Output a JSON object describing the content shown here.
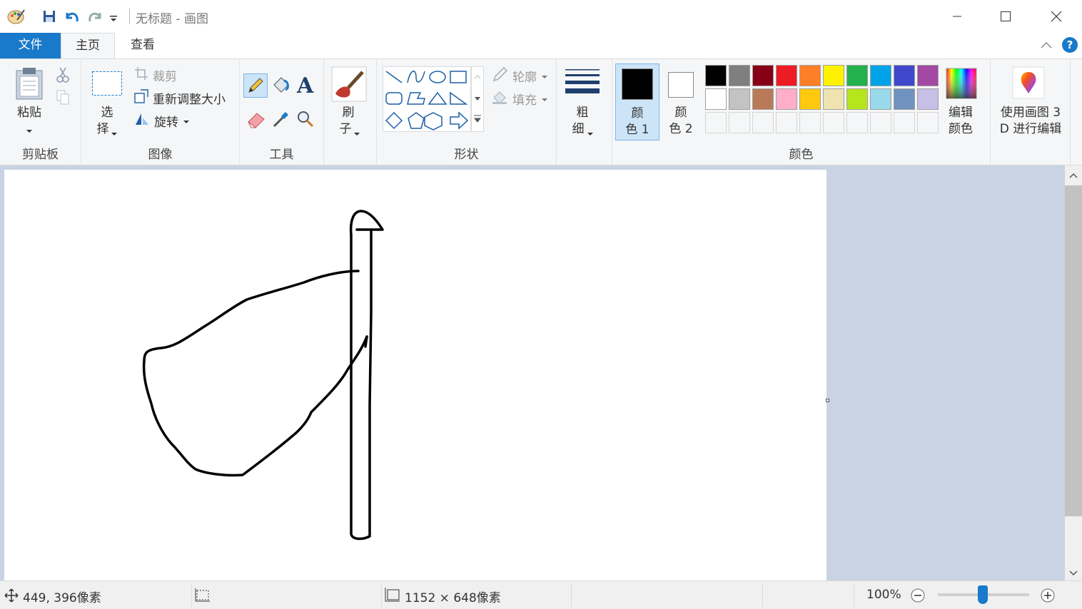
{
  "window": {
    "title": "无标题 - 画图"
  },
  "tabs": {
    "file": "文件",
    "home": "主页",
    "view": "查看"
  },
  "clipboard": {
    "paste": "粘贴",
    "group": "剪贴板"
  },
  "image": {
    "select_line1": "选",
    "select_line2": "择",
    "crop": "裁剪",
    "resize": "重新调整大小",
    "rotate": "旋转",
    "group": "图像"
  },
  "tools": {
    "group": "工具"
  },
  "brush": {
    "line1": "刷",
    "line2": "子"
  },
  "shapes": {
    "outline": "轮廓",
    "fill": "填充",
    "group": "形状"
  },
  "size": {
    "line1": "粗",
    "line2": "细"
  },
  "colors": {
    "color1_line1": "颜",
    "color1_line2": "色 1",
    "color2_line1": "颜",
    "color2_line2": "色 2",
    "edit_line1": "编辑",
    "edit_line2": "颜色",
    "group": "颜色",
    "paint3d_line1": "使用画图 3",
    "paint3d_line2": "D 进行编辑",
    "palette_row1": [
      "#000000",
      "#7f7f7f",
      "#880015",
      "#ed1c24",
      "#ff7f27",
      "#fff200",
      "#22b14c",
      "#00a2e8",
      "#3f48cc",
      "#a349a4"
    ],
    "palette_row2": [
      "#ffffff",
      "#c3c3c3",
      "#b97a57",
      "#ffaec9",
      "#ffc90e",
      "#efe4b0",
      "#b5e61d",
      "#99d9ea",
      "#7092be",
      "#c8bfe7"
    ],
    "primary": "#000000",
    "secondary": "#ffffff"
  },
  "status": {
    "cursor_pos": "449, 396像素",
    "canvas_size": "1152 × 648像素",
    "zoom": "100%"
  }
}
